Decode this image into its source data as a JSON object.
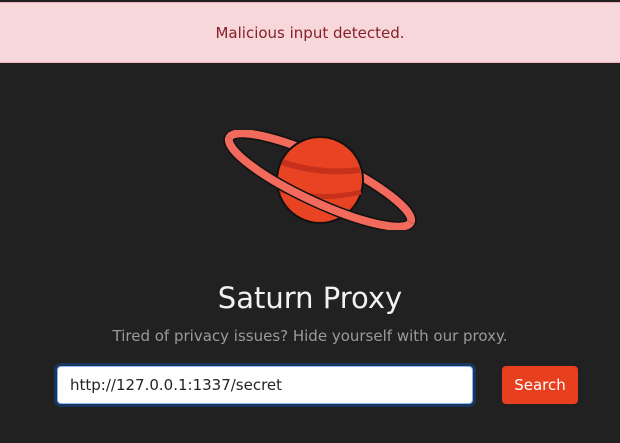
{
  "alert": {
    "message": "Malicious input detected."
  },
  "brand": {
    "logo_icon": "planet-saturn-icon",
    "title": "Saturn Proxy",
    "subtitle": "Tired of privacy issues? Hide yourself with our proxy."
  },
  "search": {
    "value": "http://127.0.0.1:1337/secret",
    "button_label": "Search"
  },
  "colors": {
    "background": "#212121",
    "alert_bg": "#f8d7da",
    "alert_text": "#842029",
    "accent": "#e8401f",
    "planet": "#e84424",
    "ring": "#f26a5b"
  }
}
